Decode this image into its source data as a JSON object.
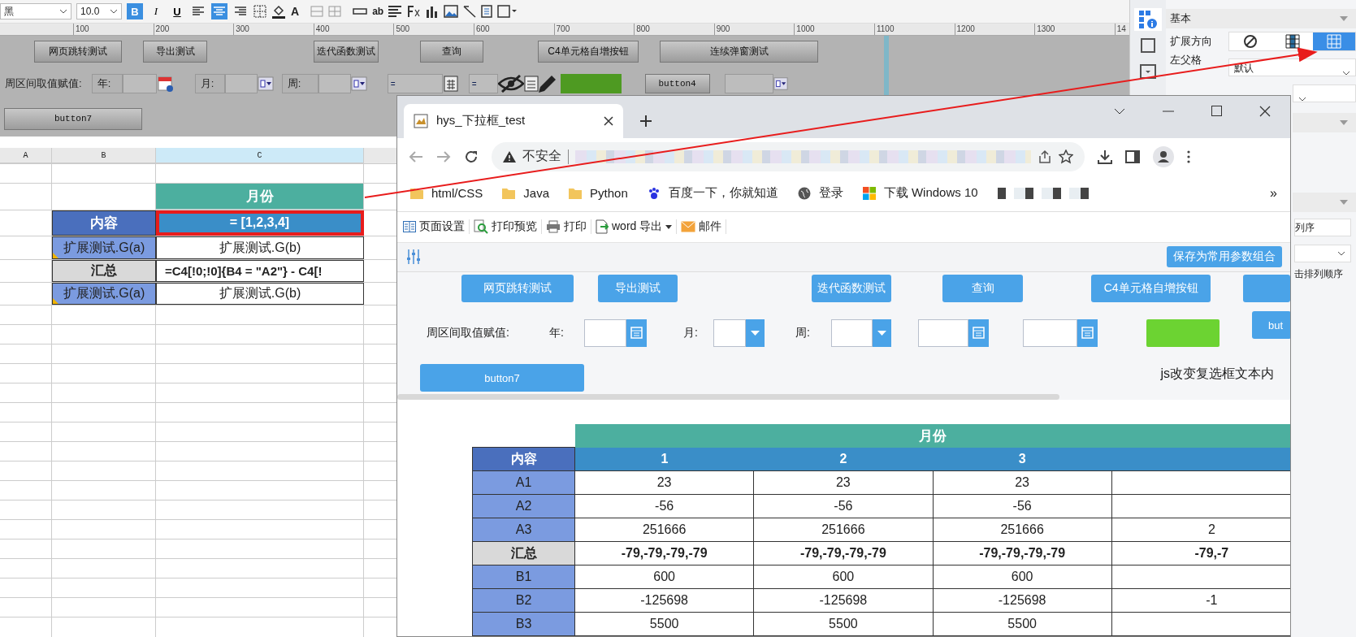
{
  "toolbar": {
    "font": "黑",
    "size": "10.0",
    "bold": {
      "label": "B",
      "on": true
    },
    "italic": "I",
    "underline": "U",
    "align": [
      {
        "kind": "left",
        "selected": false
      },
      {
        "kind": "center",
        "selected": true
      },
      {
        "kind": "right",
        "selected": false
      }
    ],
    "font_color": "A",
    "text_tool": "ab"
  },
  "ruler": [
    "100",
    "200",
    "300",
    "400",
    "500",
    "600",
    "700",
    "800",
    "900",
    "1000",
    "1100",
    "1200",
    "1300",
    "14"
  ],
  "designer": {
    "buttons": [
      "网页跳转测试",
      "导出测试",
      "迭代函数测试",
      "查询",
      "C4单元格自增按钮",
      "连续弹窗测试"
    ],
    "label": "周区间取值赋值:",
    "year": "年:",
    "month": "月:",
    "week": "周:",
    "eq1": "=",
    "eq2": "=",
    "button4": "button4",
    "button7": "button7"
  },
  "sheet": {
    "columns": [
      {
        "label": "A",
        "selected": false
      },
      {
        "label": "B",
        "selected": false
      },
      {
        "label": "C",
        "selected": true
      }
    ],
    "rows": [
      {
        "c": {
          "text": "月份",
          "kind": "title"
        }
      },
      {
        "b": {
          "text": "内容",
          "kind": "header"
        },
        "c": {
          "text": "= [1,2,3,4]",
          "kind": "selected"
        }
      },
      {
        "b": {
          "text": "扩展测试.G(a)",
          "kind": "item"
        },
        "c": {
          "text": "扩展测试.G(b)",
          "kind": "value"
        }
      },
      {
        "b": {
          "text": "汇总",
          "kind": "total"
        },
        "c": {
          "text": "=C4[!0;!0]{B4 = \"A2\"} - C4[!",
          "kind": "formula"
        }
      },
      {
        "b": {
          "text": "扩展测试.G(a)",
          "kind": "item"
        },
        "c": {
          "text": "扩展测试.G(b)",
          "kind": "value"
        }
      }
    ]
  },
  "panel": {
    "tabs": [
      {
        "kind": "cell",
        "selected": true
      },
      {
        "kind": "frame",
        "selected": false
      },
      {
        "kind": "widget",
        "selected": false
      }
    ],
    "section": "基本",
    "expand_label": "扩展方向",
    "expand_options": [
      {
        "kind": "none",
        "selected": false
      },
      {
        "kind": "vertical",
        "selected": false
      },
      {
        "kind": "horizontal",
        "selected": true
      }
    ],
    "left_parent_label": "左父格",
    "left_parent_value": "默认",
    "sort_value": "列序",
    "sort_note": "击排列顺序"
  },
  "browser": {
    "tab_title": "hys_下拉框_test",
    "security": "不安全",
    "bookmarks": [
      {
        "label": "html/CSS",
        "kind": "folder"
      },
      {
        "label": "Java",
        "kind": "folder"
      },
      {
        "label": "Python",
        "kind": "folder"
      },
      {
        "label": "百度一下，你就知道",
        "kind": "paw"
      },
      {
        "label": "登录",
        "kind": "globe"
      },
      {
        "label": "下载 Windows 10",
        "kind": "windows"
      }
    ],
    "more": "»",
    "report_toolbar": [
      {
        "label": "页面设置",
        "kind": "setup"
      },
      {
        "label": "打印预览",
        "kind": "preview"
      },
      {
        "label": "打印",
        "kind": "print"
      },
      {
        "label": "word 导出",
        "kind": "export"
      },
      {
        "label": "邮件",
        "kind": "mail"
      }
    ],
    "save_button": "保存为常用参数组合",
    "buttons": [
      "网页跳转测试",
      "导出测试",
      "迭代函数测试",
      "查询",
      "C4单元格自增按钮"
    ],
    "label": "周区间取值赋值:",
    "year": "年:",
    "month": "月:",
    "week": "周:",
    "cut_button": "but",
    "button7": "button7",
    "js_text": "js改变复选框文本内",
    "table": {
      "title": "月份",
      "corner": "内容",
      "columns": [
        "1",
        "2",
        "3"
      ],
      "rows": [
        {
          "label": "A1",
          "kind": "item",
          "values": [
            "23",
            "23",
            "23"
          ]
        },
        {
          "label": "A2",
          "kind": "item",
          "values": [
            "-56",
            "-56",
            "-56"
          ]
        },
        {
          "label": "A3",
          "kind": "item",
          "values": [
            "251666",
            "251666",
            "251666"
          ],
          "cut": "2"
        },
        {
          "label": "汇总",
          "kind": "total",
          "values": [
            "-79,-79,-79,-79",
            "-79,-79,-79,-79",
            "-79,-79,-79,-79"
          ],
          "cut": "-79,-7"
        },
        {
          "label": "B1",
          "kind": "item",
          "values": [
            "600",
            "600",
            "600"
          ]
        },
        {
          "label": "B2",
          "kind": "item",
          "values": [
            "-125698",
            "-125698",
            "-125698"
          ],
          "cut": "-1"
        },
        {
          "label": "B3",
          "kind": "item",
          "values": [
            "5500",
            "5500",
            "5500"
          ]
        }
      ]
    }
  }
}
